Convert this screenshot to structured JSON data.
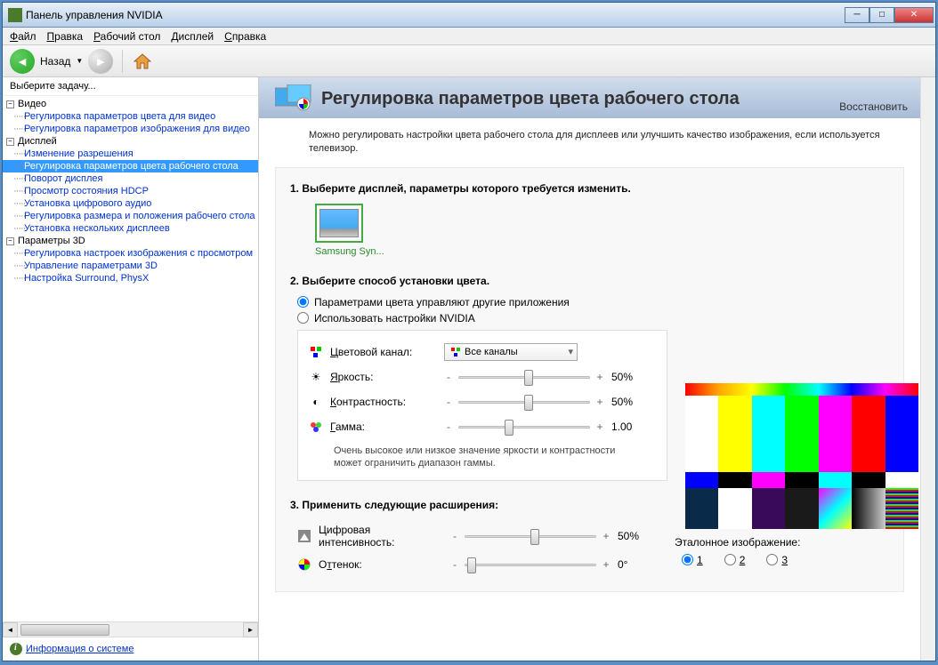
{
  "window": {
    "title": "Панель управления NVIDIA"
  },
  "menu": {
    "file": "Файл",
    "edit": "Правка",
    "desktop": "Рабочий стол",
    "display": "Дисплей",
    "help": "Справка"
  },
  "toolbar": {
    "back": "Назад"
  },
  "sidebar": {
    "title": "Выберите задачу...",
    "cats": [
      {
        "label": "Видео",
        "items": [
          "Регулировка параметров цвета для видео",
          "Регулировка параметров изображения для видео"
        ]
      },
      {
        "label": "Дисплей",
        "items": [
          "Изменение разрешения",
          "Регулировка параметров цвета рабочего стола",
          "Поворот дисплея",
          "Просмотр состояния HDCP",
          "Установка цифрового аудио",
          "Регулировка размера и положения рабочего стола",
          "Установка нескольких дисплеев"
        ],
        "selected": 1
      },
      {
        "label": "Параметры 3D",
        "items": [
          "Регулировка настроек изображения с просмотром",
          "Управление параметрами 3D",
          "Настройка Surround, PhysX"
        ]
      }
    ],
    "sysinfo": "Информация о системе"
  },
  "main": {
    "title": "Регулировка параметров цвета рабочего стола",
    "restore": "Восстановить",
    "desc": "Можно регулировать настройки цвета рабочего стола для дисплеев или улучшить качество изображения, если используется телевизор.",
    "step1": "1. Выберите дисплей, параметры которого требуется изменить.",
    "display_name": "Samsung Syn...",
    "step2": "2. Выберите способ установки цвета.",
    "radio_other": "Параметрами цвета управляют другие приложения",
    "radio_nvidia": "Использовать настройки NVIDIA",
    "channel_label": "Цветовой канал:",
    "channel_value": "Все каналы",
    "brightness_label": "Яркость:",
    "brightness_value": "50%",
    "contrast_label": "Контрастность:",
    "contrast_value": "50%",
    "gamma_label": "Гамма:",
    "gamma_value": "1.00",
    "warn": "Очень высокое или низкое значение яркости и контрастности может ограничить диапазон гаммы.",
    "step3": "3. Применить следующие расширения:",
    "vibrance_label": "Цифровая интенсивность:",
    "vibrance_value": "50%",
    "hue_label": "Оттенок:",
    "hue_value": "0°",
    "ref_label": "Эталонное изображение:",
    "ref1": "1",
    "ref2": "2",
    "ref3": "3"
  }
}
